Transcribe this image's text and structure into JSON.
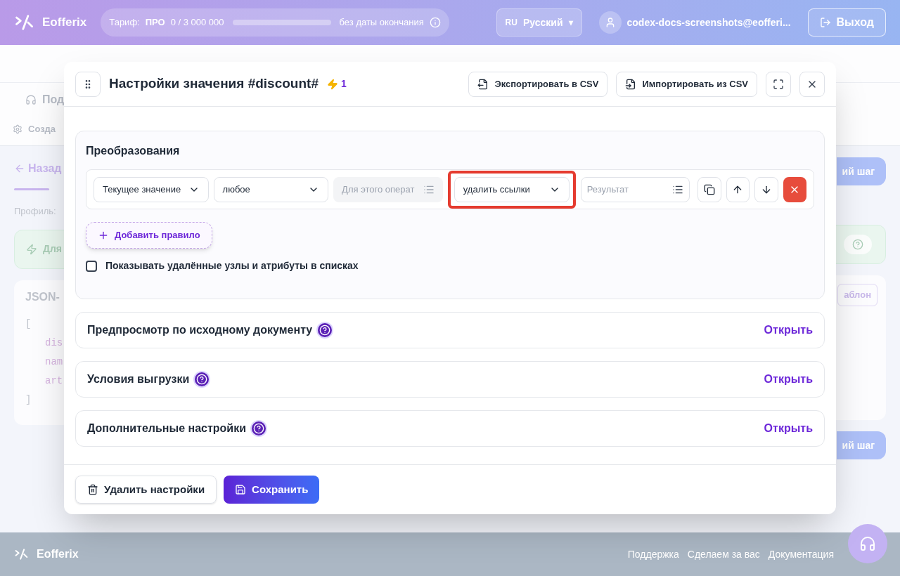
{
  "header": {
    "brand": "Eofferix",
    "tariff": {
      "label": "Тариф:",
      "plan": "ПРО",
      "usage": "0 / 3 000 000",
      "level": 0,
      "expiry": "без даты окончания"
    },
    "language": {
      "code": "RU",
      "name": "Русский",
      "caret": "▾"
    },
    "user": "codex-docs-screenshots@eofferi...",
    "logout": "Выход"
  },
  "background": {
    "nav_second": "Под",
    "breadcrumb": "Созда",
    "back_link": "Назад",
    "profile": "Профиль:",
    "notice": "Для",
    "json_title": "JSON-",
    "code_lines": [
      "[",
      "dis",
      "nam",
      "art",
      "]"
    ],
    "next_step_top": "ий шаг",
    "template_button": "аблон",
    "next_step_bottom": "ий шаг"
  },
  "modal": {
    "title": "Настройки значения #discount#",
    "bolt_count": "1",
    "export": "Экспортировать в CSV",
    "import": "Импортировать из CSV",
    "transform": {
      "title": "Преобразования",
      "rule": {
        "source": "Текущее значение",
        "condition": "любое",
        "operand_placeholder": "Для этого операт",
        "operation": "удалить ссылки",
        "operation_highlighted": true,
        "result_placeholder": "Результат"
      },
      "add_rule": "Добавить правило",
      "show_deleted": {
        "label": "Показывать удалённые узлы и атрибуты в списках",
        "checked": false
      }
    },
    "sections": [
      {
        "title": "Предпросмотр по исходному документу",
        "action": "Открыть",
        "help": true
      },
      {
        "title": "Условия выгрузки",
        "action": "Открыть",
        "help": true
      },
      {
        "title": "Дополнительные настройки",
        "action": "Открыть",
        "help": true
      }
    ],
    "delete": "Удалить настройки",
    "save": "Сохранить"
  },
  "footer": {
    "brand": "Eofferix",
    "links": [
      "Поддержка",
      "Сделаем за вас",
      "Документация"
    ]
  }
}
